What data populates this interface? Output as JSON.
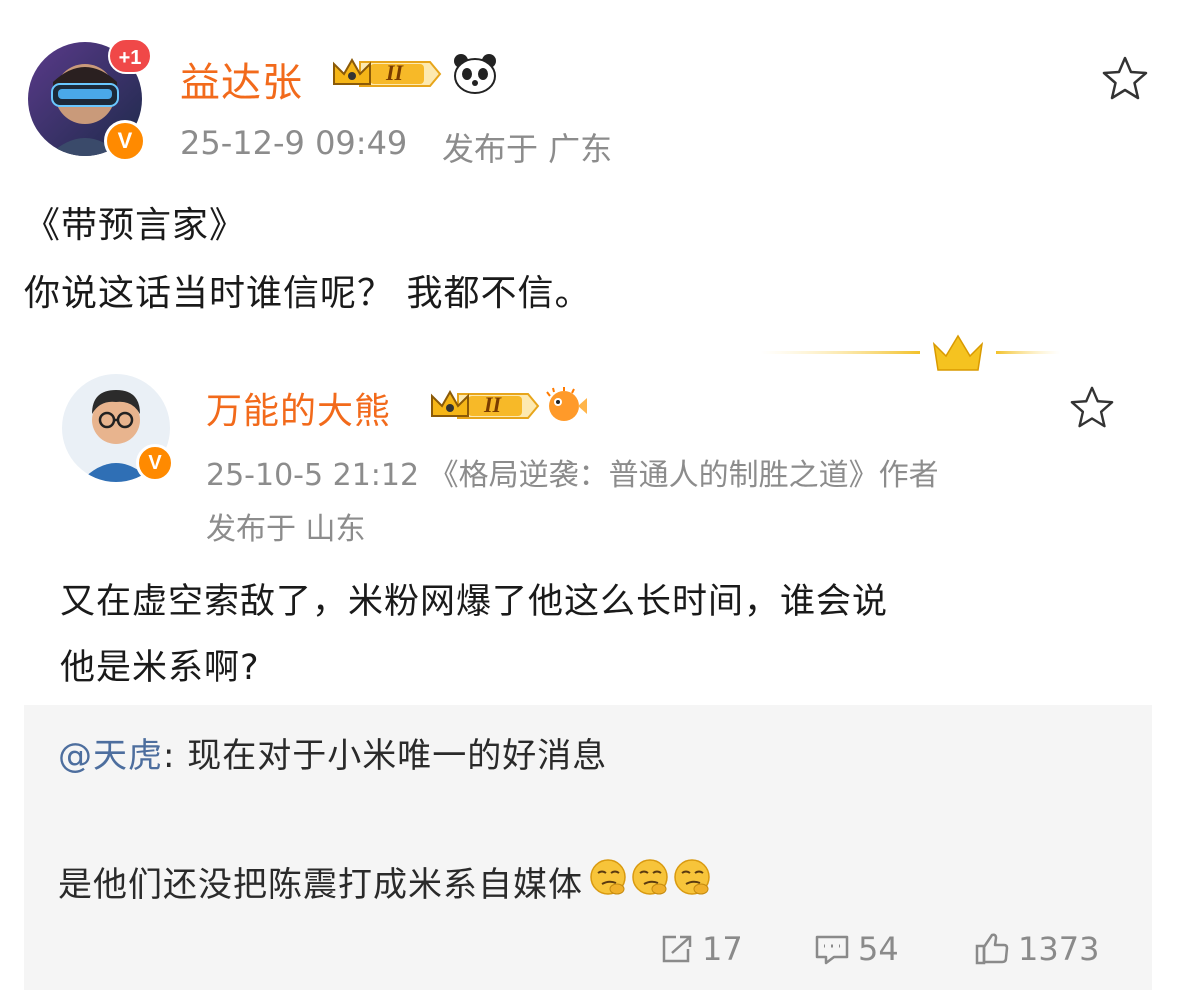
{
  "main_post": {
    "author": "益达张",
    "notification_count": "+1",
    "verified_mark": "V",
    "time": "25-12-9 09:49",
    "location": "发布于 广东",
    "text_line1": "《带预言家》",
    "text_line2": "你说这话当时谁信呢？ 我都不信。",
    "level_badge": "II",
    "badge_icon": "panda-icon"
  },
  "quoted_post": {
    "author": "万能的大熊",
    "verified_mark": "V",
    "level_badge": "II",
    "badge_icon": "pufferfish-icon",
    "meta_line1": "25-10-5 21:12 《格局逆袭：普通人的制胜之道》作者",
    "meta_line2": "发布于 山东",
    "text_line1": "又在虚空索敌了，米粉网爆了他这么长时间，谁会说",
    "text_line2": "他是米系啊?",
    "reply": {
      "mention": "@天虎",
      "text_line1": ": 现在对于小米唯一的好消息",
      "text_line2": "是他们还没把陈震打成米系自媒体"
    },
    "stats": {
      "reposts": "17",
      "comments": "54",
      "likes": "1373"
    }
  },
  "colors": {
    "name": "#f26a1b",
    "meta": "#8c8c8c",
    "mention": "#4d6e9e",
    "quote_bg": "#f5f5f5",
    "verified": "#ff8a00"
  }
}
